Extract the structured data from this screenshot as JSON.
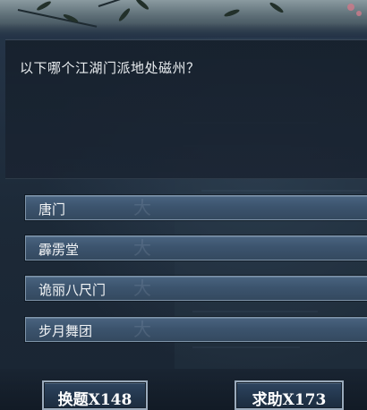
{
  "question": {
    "text": "以下哪个江湖门派地处磁州？"
  },
  "options": [
    {
      "label": "唐门"
    },
    {
      "label": "霹雳堂"
    },
    {
      "label": "诡丽八尺门"
    },
    {
      "label": "步月舞团"
    }
  ],
  "actions": {
    "swap_label": "换题X148",
    "help_label": "求助X173"
  },
  "colors": {
    "option_fill": "#3c546e",
    "option_border": "#7e93a8",
    "button_border": "#9aaabb",
    "question_text": "#e8ecef"
  },
  "icons": {
    "option_watermark": "ink-seal-icon"
  }
}
